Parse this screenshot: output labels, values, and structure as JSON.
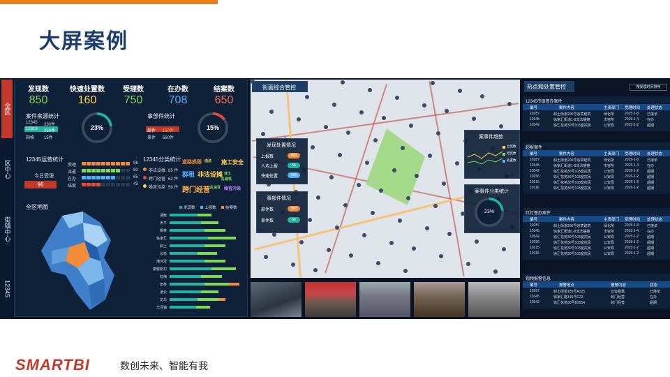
{
  "slide": {
    "title": "大屏案例",
    "logo": "SMARTBI",
    "slogan": "数创未来、智能有我"
  },
  "tabs": [
    {
      "label": "全区",
      "active": true
    },
    {
      "label": "区中心"
    },
    {
      "label": "街镇中心"
    },
    {
      "label": "12345"
    }
  ],
  "kpis": [
    {
      "label": "发现数",
      "value": "850",
      "color": "#7ed957"
    },
    {
      "label": "快速处置数",
      "value": "160",
      "color": "#ffd34d"
    },
    {
      "label": "受理数",
      "value": "750",
      "color": "#7ed957"
    },
    {
      "label": "在办数",
      "value": "708",
      "color": "#4fb3ff"
    },
    {
      "label": "结案数",
      "value": "650",
      "color": "#ff6b5a"
    }
  ],
  "source_stats": {
    "title": "案件来源统计",
    "rows": [
      {
        "k": "12345",
        "v": "230件"
      },
      {
        "k": "12319",
        "v": "250件"
      },
      {
        "k": "网格",
        "v": "15件"
      }
    ],
    "pct": "23%",
    "pct_value": 23
  },
  "event_stats": {
    "title": "事部件统计",
    "rows": [
      {
        "k": "部件",
        "v": "150件"
      },
      {
        "k": "事件",
        "v": "650件"
      }
    ],
    "pct": "15%",
    "pct_value": 15
  },
  "ops_stats": {
    "title": "12345运营统计",
    "today_label": "今日受理",
    "today_value": "96",
    "rows": [
      {
        "k": "受理",
        "v": "96",
        "fill": 0.96
      },
      {
        "k": "派遣",
        "v": "80",
        "fill": 0.8
      },
      {
        "k": "在办",
        "v": "65",
        "fill": 0.65
      },
      {
        "k": "结案",
        "v": "43",
        "fill": 0.43
      }
    ]
  },
  "category_stats": {
    "title": "12345分类统计",
    "rows": [
      {
        "k": "非法设摊",
        "v": "85 件"
      },
      {
        "k": "跨门经营",
        "v": "62 件"
      },
      {
        "k": "噪音污染",
        "v": "58 件"
      }
    ],
    "words": [
      "道路损毁",
      "违法",
      "施工安全",
      "群租",
      "非法设摊",
      "渣土",
      "乱建筑",
      "跨门经营",
      "乱涂写",
      "噪音污染"
    ]
  },
  "district_map": {
    "title": "全区地图"
  },
  "district_chart": {
    "legend": [
      "发现数",
      "上报数",
      "结案数"
    ],
    "rows": [
      "湖畈",
      "天平",
      "枫林",
      "徐家汇",
      "斜土",
      "长桥",
      "漕河泾",
      "康健新村",
      "虹梅",
      "田林",
      "凌云",
      "龙华",
      "华泾镇"
    ]
  },
  "map": {
    "title": "街面综合管控",
    "dispose": {
      "title": "发现处置情况",
      "rows": [
        {
          "k": "上报数",
          "v": "800"
        },
        {
          "k": "人均上报",
          "v": "56"
        },
        {
          "k": "快速处置",
          "v": "665"
        }
      ]
    },
    "event": {
      "title": "事部件情况",
      "rows": [
        {
          "k": "部件数",
          "v": "800"
        },
        {
          "k": "事件数",
          "v": "56"
        }
      ]
    },
    "trend": {
      "title": "案事件趋势",
      "legend": [
        "立案数",
        "结案数",
        "处置数"
      ]
    },
    "category": {
      "title": "案事件分类统计",
      "pct": "23%",
      "pct_value": 23
    }
  },
  "right": {
    "title": "热点和处置管控",
    "sort": "按受理时间排序",
    "blocks": [
      {
        "caption": "12345市级督办案件",
        "headers": [
          "编号",
          "案件内容",
          "主责部门",
          "受理时间",
          "处理状态"
        ],
        "rows": [
          [
            "10287",
            "斜土街道200号违章建筑",
            "绿化所",
            "2015-1-8",
            "已接单"
          ],
          [
            "10345",
            "徐家汇街道1-8非法摆摊",
            "市容所",
            "2015-1-4",
            "在办"
          ],
          [
            "10542",
            "徐汇花苑30号103室扰民",
            "公安局",
            "2015-1-2",
            "超期"
          ]
        ]
      },
      {
        "caption": "超报案件",
        "headers": [
          "编号",
          "案件内容",
          "主责部门",
          "受理时间",
          "处理状态"
        ],
        "rows": [
          [
            "10287",
            "斜土街道200号违章建筑",
            "绿化所",
            "2015-1-8",
            "已接单"
          ],
          [
            "10345",
            "徐家汇街道1-8非法摆摊",
            "市容所",
            "2015-1-4",
            "在办"
          ],
          [
            "10542",
            "徐汇花苑30号103室扰民",
            "公安局",
            "2015-1-2",
            "超期"
          ],
          [
            "10256",
            "徐汇花苑30号103室扰民",
            "公安局",
            "2015-1-2",
            "超期"
          ],
          [
            "10215",
            "徐汇花苑30号103室扰民",
            "公安局",
            "2015-1-2",
            "超期"
          ],
          [
            "10116",
            "徐汇花苑30号103室扰民",
            "公安局",
            "2015-1-2",
            "超期"
          ]
        ]
      },
      {
        "caption": "红灯督办案件",
        "headers": [
          "编号",
          "案件内容",
          "主责部门",
          "受理时间",
          "处理状态"
        ],
        "rows": [
          [
            "10287",
            "斜土街道200号违章建筑",
            "绿化所",
            "2015-1-8",
            "已接单"
          ],
          [
            "10345",
            "徐家汇街道1-8非法摆摊",
            "市容所",
            "2015-1-4",
            "在办"
          ],
          [
            "10542",
            "徐汇花苑30号103室扰民",
            "公安局",
            "2015-1-2",
            "超期"
          ],
          [
            "10256",
            "徐汇花苑30号103室扰民",
            "公安局",
            "2015-1-2",
            "超期"
          ],
          [
            "10215",
            "徐汇花苑30号103室扰民",
            "公安局",
            "2015-1-2",
            "超期"
          ],
          [
            "10116",
            "徐汇花苑30号103室扰民",
            "公安局",
            "2015-1-2",
            "超期"
          ]
        ]
      },
      {
        "caption": "视频报警信息",
        "headers": [
          "编号",
          "报警地点",
          "报警内容",
          "状态"
        ],
        "rows": [
          [
            "10287",
            "斜土街道185号A125",
            "垃圾暴露",
            "已接单"
          ],
          [
            "10345",
            "徐家汇路145号C23",
            "跨门经营",
            "在办"
          ],
          [
            "10542",
            "徐汇花苑30号B2554",
            "跨门经营",
            "超期"
          ]
        ]
      }
    ]
  }
}
